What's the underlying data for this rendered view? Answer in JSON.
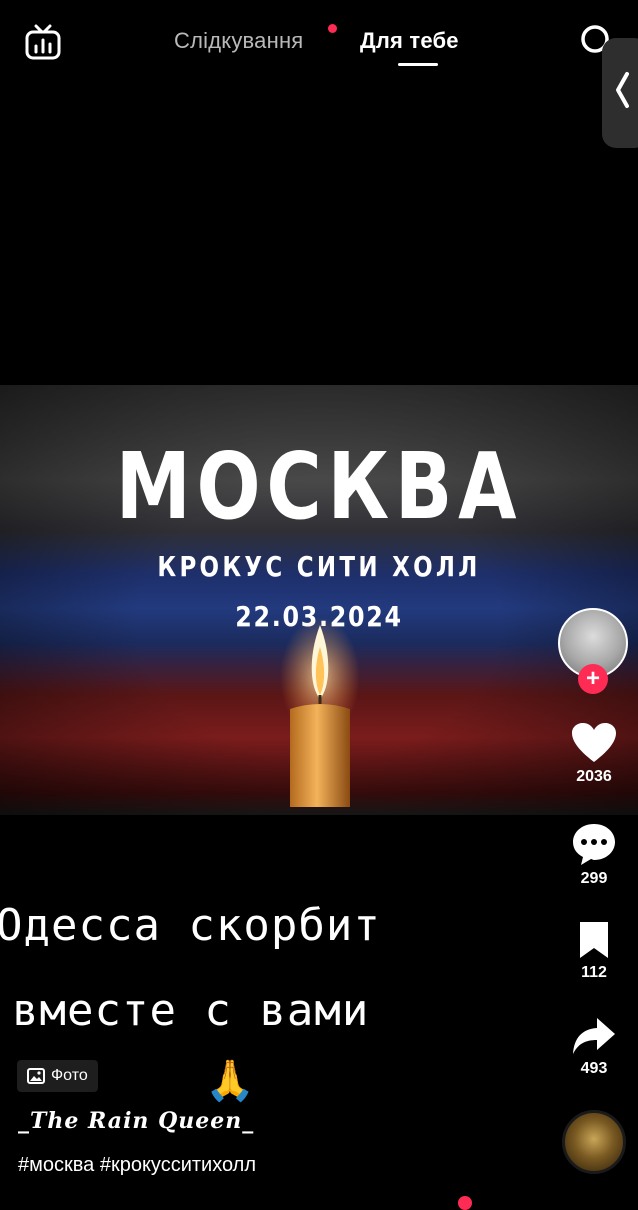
{
  "top_bar": {
    "tabs": [
      {
        "label": "Слідкування"
      },
      {
        "label": "Для тебе"
      }
    ]
  },
  "media": {
    "title": "МОСКВА",
    "subtitle": "КРОКУС СИТИ ХОЛЛ",
    "date": "22.03.2024"
  },
  "actions": {
    "follow_label": "+",
    "likes": "2036",
    "comments": "299",
    "saves": "112",
    "shares": "493"
  },
  "caption": {
    "line1": "Одесса скорбит",
    "line2": "вместе с вами"
  },
  "post": {
    "photo_badge": "Фото",
    "emoji": "🙏",
    "author": "_The Rain Queen_",
    "hashtags": "#москва #крокусситихолл"
  },
  "colors": {
    "accent": "#fe2c55",
    "background": "#000000"
  },
  "icons": [
    "live-tv-icon",
    "search-icon",
    "chevron-left-icon",
    "heart-icon",
    "comment-icon",
    "bookmark-icon",
    "share-icon",
    "image-icon"
  ]
}
